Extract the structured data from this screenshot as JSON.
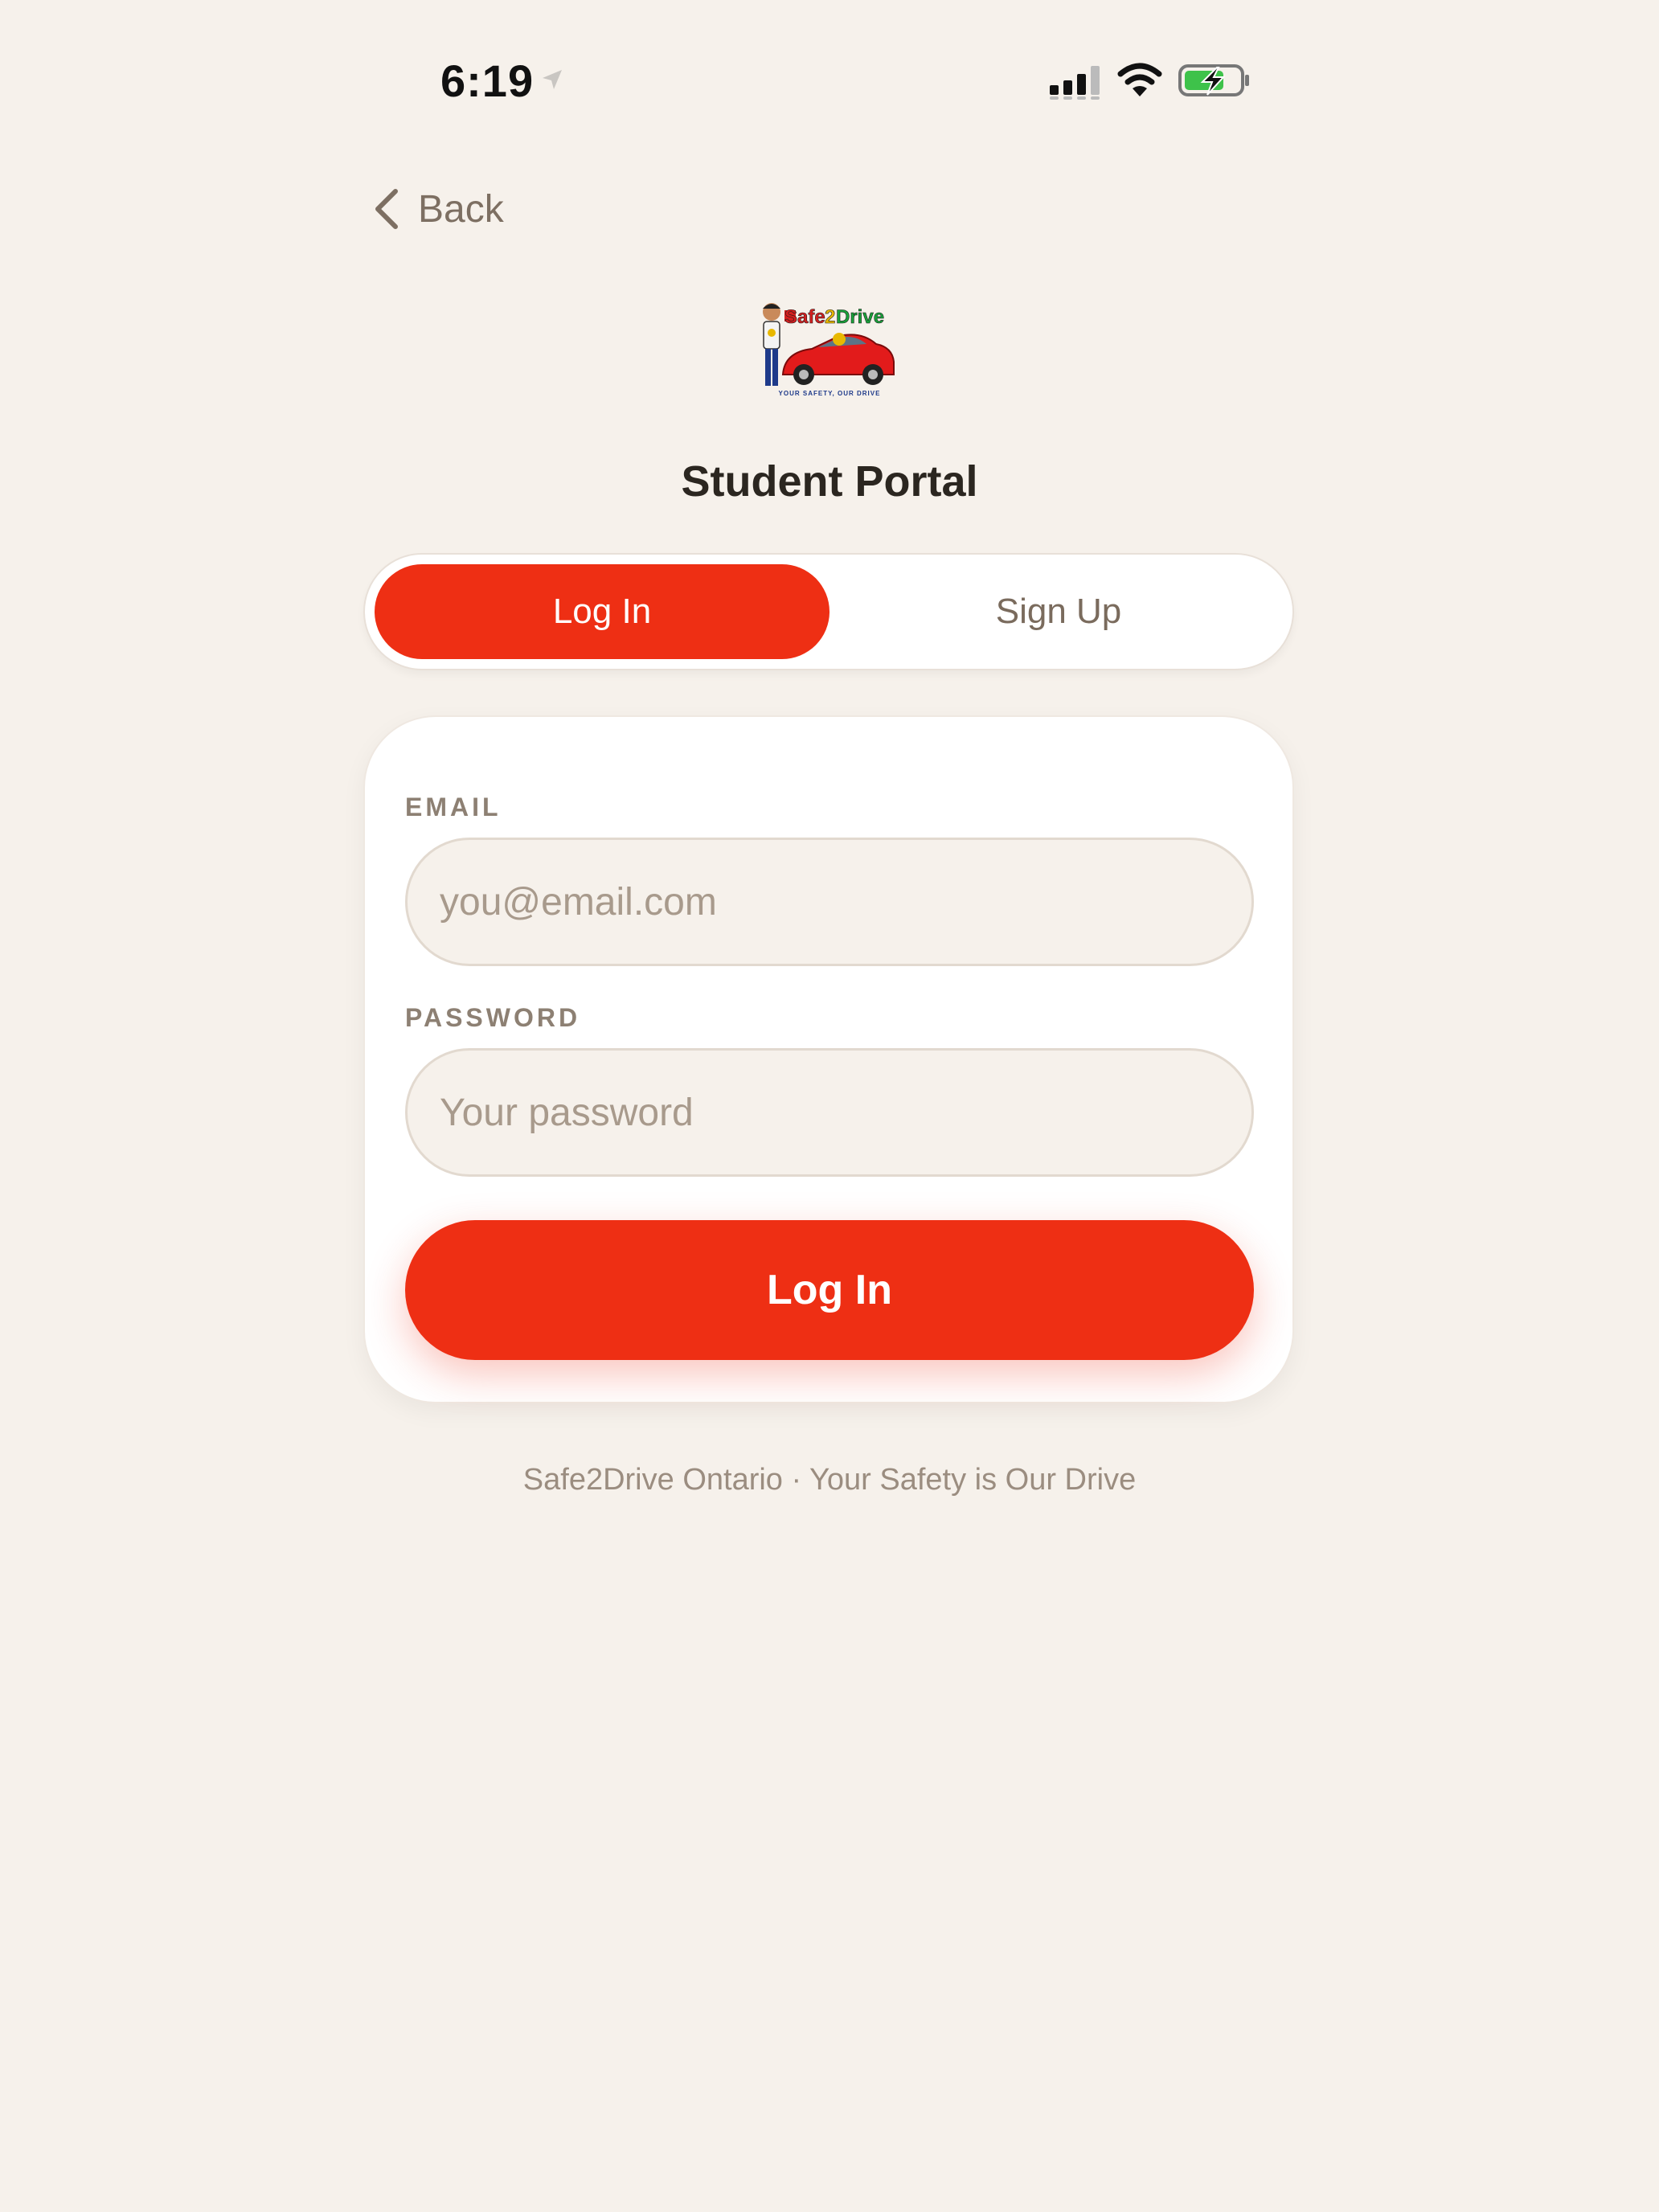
{
  "status_bar": {
    "time": "6:19"
  },
  "nav": {
    "back_label": "Back"
  },
  "logo": {
    "text": "Safe2Drive",
    "tagline": "YOUR SAFETY, OUR DRIVE"
  },
  "page": {
    "title": "Student Portal"
  },
  "tabs": [
    {
      "label": "Log In",
      "active": true
    },
    {
      "label": "Sign Up",
      "active": false
    }
  ],
  "form": {
    "email_label": "EMAIL",
    "email_placeholder": "you@email.com",
    "email_value": "",
    "password_label": "PASSWORD",
    "password_placeholder": "Your password",
    "password_value": "",
    "submit_label": "Log In"
  },
  "footer": {
    "text": "Safe2Drive Ontario · Your Safety is Our Drive"
  },
  "colors": {
    "accent": "#ee2f14",
    "background": "#f6f1eb",
    "card": "#ffffff",
    "muted": "#8d8073"
  }
}
